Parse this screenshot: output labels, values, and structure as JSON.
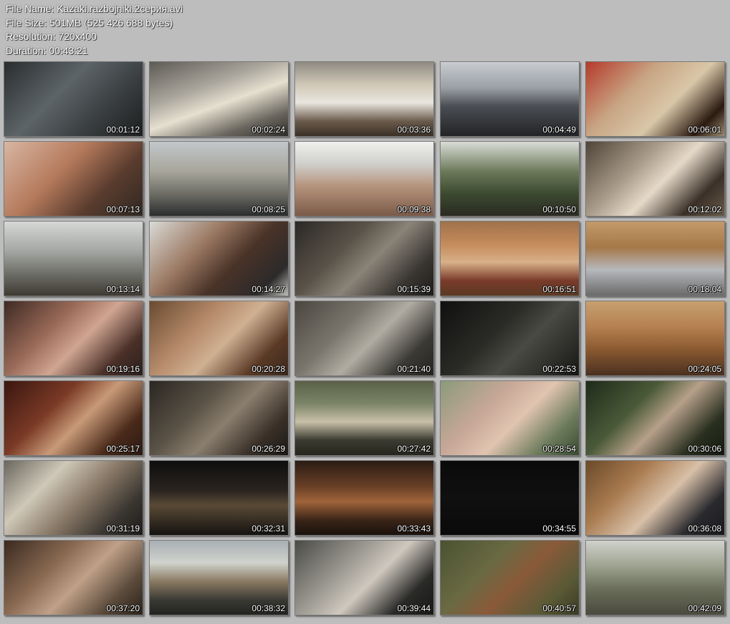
{
  "header": {
    "file_name": "File Name: Kazaki.razbojniki.2серия.avi",
    "file_size": "File Size: 501MB (525 426 688 bytes)",
    "resolution": "Resolution: 720x400",
    "duration": "Duration: 00:43:21"
  },
  "thumbnails": [
    {
      "time": "00:01:12",
      "bg": "linear-gradient(135deg,#2a2d2e 0%,#5c6468 40%,#3a3e40 70%,#1c1e1f 100%)"
    },
    {
      "time": "00:02:24",
      "bg": "linear-gradient(160deg,#5d5a55 0%,#a9a59c 35%,#e6e0d0 55%,#6a665e 80%,#2e2c29 100%)"
    },
    {
      "time": "00:03:36",
      "bg": "linear-gradient(180deg,#8e8a82 0%,#cfc6b6 30%,#e9e6df 55%,#6b5b4c 80%,#3a3026 100%)"
    },
    {
      "time": "00:04:49",
      "bg": "linear-gradient(180deg,#c9ccd0 0%,#9aa0a6 35%,#4a4d52 60%,#222427 100%)"
    },
    {
      "time": "00:06:01",
      "bg": "linear-gradient(135deg,#b53a2a 0%,#c8a584 35%,#d9c7a8 60%,#2a1a10 85%,#9a8a70 100%)"
    },
    {
      "time": "00:07:13",
      "bg": "linear-gradient(135deg,#d8b6a3 0%,#b57a5c 40%,#5a3c2e 70%,#2f2823 100%)"
    },
    {
      "time": "00:08:25",
      "bg": "linear-gradient(180deg,#c2c7cb 0%,#a8a69c 40%,#6e6e66 70%,#2a2c2e 100%)"
    },
    {
      "time": "00:09:38",
      "bg": "linear-gradient(180deg,#f0f0ee 0%,#cfcfcb 30%,#b6937c 60%,#7a5a48 100%)"
    },
    {
      "time": "00:10:50",
      "bg": "linear-gradient(180deg,#d9dcd6 0%,#6c7a5a 40%,#3c4a30 70%,#2a2a22 100%)"
    },
    {
      "time": "00:12:02",
      "bg": "linear-gradient(135deg,#4e4438 0%,#a89a88 35%,#e5d9c8 55%,#3a3028 80%,#6a5a48 100%)"
    },
    {
      "time": "00:13:14",
      "bg": "linear-gradient(180deg,#d6d8d6 0%,#a3a6a2 40%,#6e6f68 70%,#3e3a32 100%)"
    },
    {
      "time": "00:14:27",
      "bg": "linear-gradient(135deg,#d9dad6 0%,#9c7a64 35%,#4a3328 60%,#2c2a2a 85%,#bdbdb8 100%)"
    },
    {
      "time": "00:15:39",
      "bg": "linear-gradient(135deg,#2a2826 0%,#5a5248 35%,#8a8478 55%,#3a3632 80%,#1e1c1a 100%)"
    },
    {
      "time": "00:16:51",
      "bg": "linear-gradient(180deg,#a0714a 0%,#c48a5a 30%,#d8b088 55%,#7a3a2a 80%,#5a3a24 100%)"
    },
    {
      "time": "00:18:04",
      "bg": "linear-gradient(180deg,#c39a6a 0%,#a67848 35%,#b6b8bc 65%,#6a6a6a 100%)"
    },
    {
      "time": "00:19:16",
      "bg": "linear-gradient(135deg,#3e2a24 0%,#9a6a58 35%,#d0a592 55%,#4a3028 80%,#2a201c 100%)"
    },
    {
      "time": "00:20:28",
      "bg": "linear-gradient(135deg,#6a4a30 0%,#b58a6a 35%,#d0b092 55%,#5a3a26 80%,#3a281c 100%)"
    },
    {
      "time": "00:21:40",
      "bg": "linear-gradient(135deg,#4a4640 0%,#7a756c 35%,#b0aca2 55%,#3c3a36 80%,#26241f 100%)"
    },
    {
      "time": "00:22:53",
      "bg": "linear-gradient(135deg,#101010 0%,#2a2a26 40%,#4a4a44 60%,#161614 100%)"
    },
    {
      "time": "00:24:05",
      "bg": "linear-gradient(180deg,#c8a070 0%,#b58050 35%,#8a5a30 65%,#4a3020 100%)"
    },
    {
      "time": "00:25:17",
      "bg": "linear-gradient(135deg,#3a1610 0%,#7a3a26 35%,#c89a78 55%,#4a2a1a 80%,#2a1a12 100%)"
    },
    {
      "time": "00:26:29",
      "bg": "linear-gradient(135deg,#2a2622 0%,#5a5246 35%,#8a7e6e 55%,#3a3028 80%,#1a1816 100%)"
    },
    {
      "time": "00:27:42",
      "bg": "linear-gradient(180deg,#5a6048 0%,#7a8466 30%,#c8c0a8 55%,#3a3a30 80%,#26261e 100%)"
    },
    {
      "time": "00:28:54",
      "bg": "linear-gradient(135deg,#8a9a7a 0%,#c8a898 35%,#e0c4b0 55%,#6a7a5a 80%,#3a4a30 100%)"
    },
    {
      "time": "00:30:06",
      "bg": "linear-gradient(135deg,#1e2a1a 0%,#4a5a38 35%,#b6a08a 55%,#2a3020 80%,#141a10 100%)"
    },
    {
      "time": "00:31:19",
      "bg": "linear-gradient(135deg,#6a665e 0%,#cfc8b8 30%,#8a7a68 55%,#3a3630 80%,#1e1c1a 100%)"
    },
    {
      "time": "00:32:31",
      "bg": "linear-gradient(180deg,#0e0e0e 0%,#2a2420 40%,#5a4a36 60%,#141210 100%)"
    },
    {
      "time": "00:33:43",
      "bg": "linear-gradient(180deg,#2a1c14 0%,#6a4026 35%,#a0643a 55%,#3a2418 80%,#1a120c 100%)"
    },
    {
      "time": "00:34:55",
      "bg": "linear-gradient(180deg,#0a0a0a 0%,#101010 50%,#0a0a0a 100%)"
    },
    {
      "time": "00:36:08",
      "bg": "linear-gradient(135deg,#6a4a2a 0%,#a87a4e 30%,#d8c0a8 55%,#2a2a2e 80%,#1a1a1e 100%)"
    },
    {
      "time": "00:37:20",
      "bg": "linear-gradient(135deg,#3a2a20 0%,#8a6a52 35%,#c0a088 55%,#5a4a3a 80%,#2a221c 100%)"
    },
    {
      "time": "00:38:32",
      "bg": "linear-gradient(180deg,#a8b0b4 0%,#d0d2cc 30%,#8a7a62 55%,#3a3a34 80%,#222220 100%)"
    },
    {
      "time": "00:39:44",
      "bg": "linear-gradient(135deg,#4a4a46 0%,#9a9890 35%,#cfc8be 55%,#2a2a28 80%,#181816 100%)"
    },
    {
      "time": "00:40:57",
      "bg": "linear-gradient(135deg,#4a5232 0%,#6a6a42 35%,#8a5a3a 55%,#5a5a36 80%,#3a3a24 100%)"
    },
    {
      "time": "00:42:09",
      "bg": "linear-gradient(180deg,#d0d2cc 0%,#9ca28e 35%,#6a6e5a 65%,#4a4a3e 100%)"
    }
  ]
}
